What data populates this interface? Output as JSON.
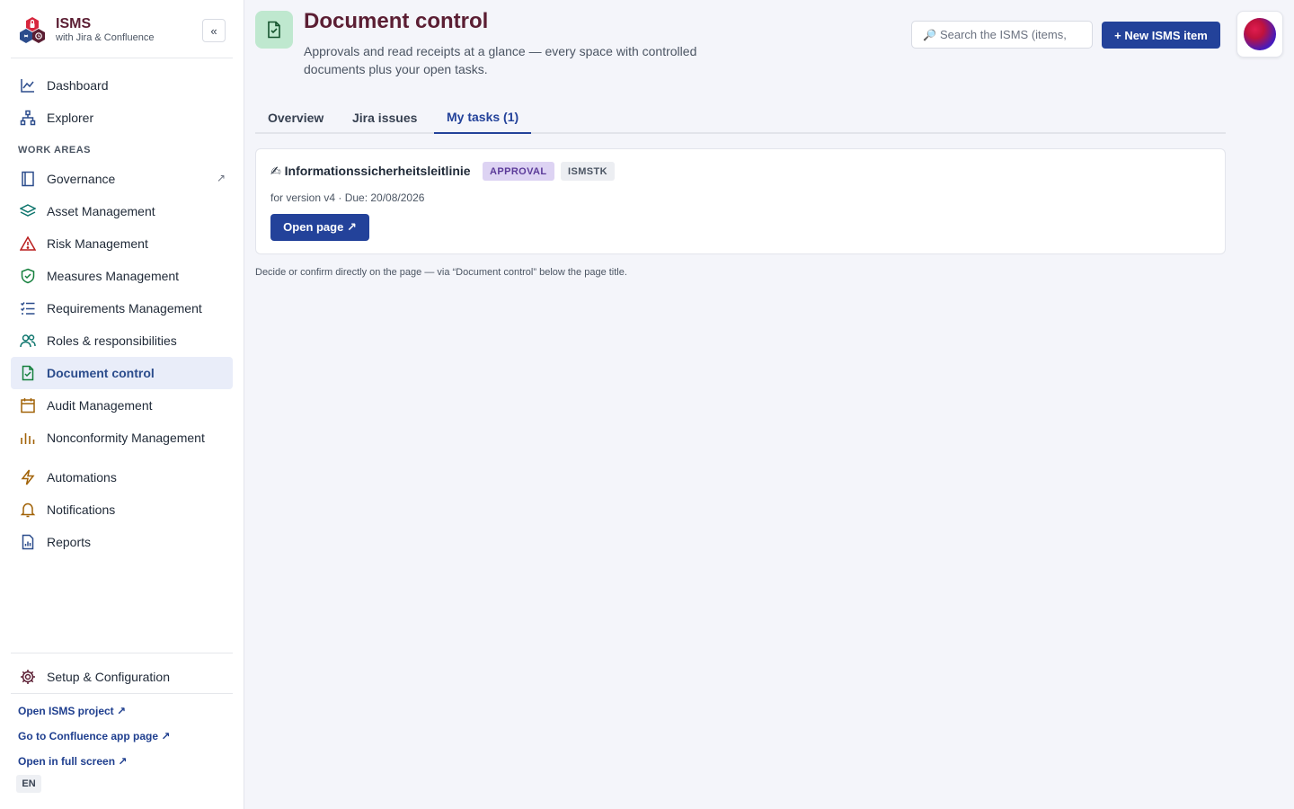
{
  "brand": {
    "title": "ISMS",
    "subtitle": "with Jira & Confluence",
    "collapse_label": "«"
  },
  "sidebar": {
    "items_top": [
      {
        "label": "Dashboard",
        "icon": "chart-line-icon"
      },
      {
        "label": "Explorer",
        "icon": "hierarchy-icon"
      }
    ],
    "section_label": "WORK AREAS",
    "work_areas": [
      {
        "label": "Governance",
        "icon": "book-icon",
        "external": "↗"
      },
      {
        "label": "Asset Management",
        "icon": "layers-icon"
      },
      {
        "label": "Risk Management",
        "icon": "warning-icon"
      },
      {
        "label": "Measures Management",
        "icon": "shield-check-icon"
      },
      {
        "label": "Requirements Management",
        "icon": "checklist-icon"
      },
      {
        "label": "Roles & responsibilities",
        "icon": "users-icon"
      },
      {
        "label": "Document control",
        "icon": "document-check-icon",
        "active": true
      },
      {
        "label": "Audit Management",
        "icon": "calendar-icon"
      },
      {
        "label": "Nonconformity Management",
        "icon": "bar-chart-icon"
      }
    ],
    "items_more": [
      {
        "label": "Automations",
        "icon": "lightning-icon"
      },
      {
        "label": "Notifications",
        "icon": "bell-icon"
      },
      {
        "label": "Reports",
        "icon": "report-icon"
      }
    ],
    "setup": {
      "label": "Setup & Configuration",
      "icon": "gear-icon"
    },
    "footer_links": [
      "Open ISMS project ↗",
      "Go to Confluence app page ↗",
      "Open in full screen ↗"
    ],
    "language": "EN"
  },
  "header": {
    "title": "Document control",
    "description": "Approvals and read receipts at a glance — every space with controlled documents plus your open tasks.",
    "search_placeholder": "Search the ISMS (items,",
    "new_button": "+ New ISMS item"
  },
  "tabs": [
    {
      "label": "Overview",
      "active": false
    },
    {
      "label": "Jira issues",
      "active": false
    },
    {
      "label": "My tasks (1)",
      "active": true
    }
  ],
  "task": {
    "icon": "✍",
    "title": "Informationssicherheitsleitlinie",
    "type_badge": "APPROVAL",
    "space_badge": "ISMSTK",
    "meta": "for version v4 · Due: 20/08/2026",
    "open_button": "Open page ↗"
  },
  "hint": "Decide or confirm directly on the page — via “Document control” below the page title.",
  "colors": {
    "accent": "#23429a",
    "title": "#5b1e33",
    "active_nav_bg": "#e9edf9",
    "page_icon_bg": "#bfe8cf"
  }
}
